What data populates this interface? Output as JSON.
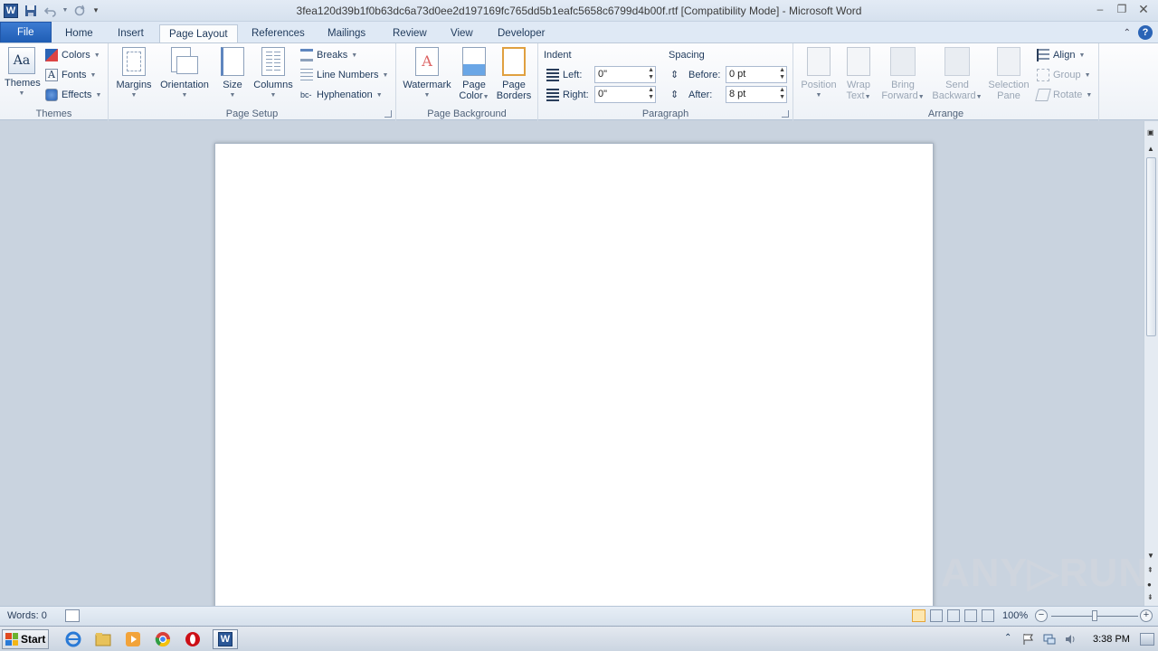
{
  "window": {
    "title": "3fea120d39b1f0b63dc6a73d0ee2d197169fc765dd5b1eafc5658c6799d4b00f.rtf [Compatibility Mode]  -  Microsoft Word",
    "app_logo_letter": "W"
  },
  "tabs": {
    "file": "File",
    "home": "Home",
    "insert": "Insert",
    "page_layout": "Page Layout",
    "references": "References",
    "mailings": "Mailings",
    "review": "Review",
    "view": "View",
    "developer": "Developer",
    "help_glyph": "?"
  },
  "ribbon": {
    "themes": {
      "label": "Themes",
      "themes_btn": "Themes",
      "themes_icon_text": "Aa",
      "colors": "Colors",
      "fonts": "Fonts",
      "effects": "Effects"
    },
    "page_setup": {
      "label": "Page Setup",
      "margins": "Margins",
      "orientation": "Orientation",
      "size": "Size",
      "columns": "Columns",
      "breaks": "Breaks",
      "line_numbers": "Line Numbers",
      "hyphenation": "Hyphenation"
    },
    "page_background": {
      "label": "Page Background",
      "watermark": "Watermark",
      "page_color_1": "Page",
      "page_color_2": "Color",
      "page_borders_1": "Page",
      "page_borders_2": "Borders"
    },
    "paragraph": {
      "label": "Paragraph",
      "indent": "Indent",
      "left_label": "Left:",
      "left_value": "0\"",
      "right_label": "Right:",
      "right_value": "0\"",
      "spacing": "Spacing",
      "before_label": "Before:",
      "before_value": "0 pt",
      "after_label": "After:",
      "after_value": "8 pt"
    },
    "arrange": {
      "label": "Arrange",
      "position": "Position",
      "wrap_text_1": "Wrap",
      "wrap_text_2": "Text",
      "bring_forward_1": "Bring",
      "bring_forward_2": "Forward",
      "send_backward_1": "Send",
      "send_backward_2": "Backward",
      "selection_pane_1": "Selection",
      "selection_pane_2": "Pane",
      "align": "Align",
      "group": "Group",
      "rotate": "Rotate"
    }
  },
  "status": {
    "words": "Words: 0",
    "zoom": "100%"
  },
  "watermark_text": "ANY▷RUN",
  "taskbar": {
    "start": "Start",
    "clock": "3:38 PM"
  },
  "colors": {
    "file_tab": "#1f5db4",
    "ribbon_bg": "#eef2f7",
    "doc_bg": "#c9d3df",
    "word_blue": "#2b5797"
  }
}
